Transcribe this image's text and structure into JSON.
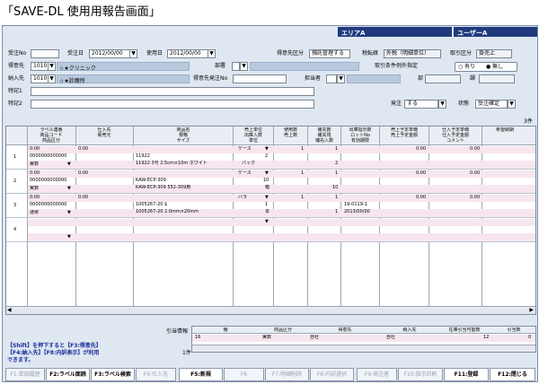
{
  "page_title": "「SAVE-DL 使用用報告画面」",
  "header": {
    "area": "エリアA",
    "user": "ユーザーA"
  },
  "form": {
    "juchu_no_label": "受注No",
    "juchu_no": "",
    "juchu_date_label": "受注日",
    "juchu_date": "2012/00/00",
    "use_date_label": "使用日",
    "use_date": "2012/00/00",
    "client_type_label": "得意先区分",
    "client_type": "預託管理する",
    "tax_label": "税転嫁",
    "tax": "外税（明細単位）",
    "deal_type_label": "取引区分",
    "deal_type": "掛売上",
    "client_label": "得意先",
    "client_code": "1010",
    "client_name": "☆★クリニック",
    "dept_label": "部署",
    "dept": "",
    "cond_label": "取引条件例外指定",
    "cond_yes": "有り",
    "cond_no": "無し",
    "dest_label": "納入先",
    "dest_code": "1010",
    "dest_name": "☆★診療所",
    "order_no_label": "得意先発注No",
    "order_no": "",
    "staff_label": "担当者",
    "staff": "",
    "section_label": "部",
    "section": "",
    "division_label": "課",
    "division": "",
    "note1_label": "特記1",
    "note1": "",
    "note2_label": "特記2",
    "note2": "",
    "order_flag_label": "発注",
    "order_flag": "する",
    "status_label": "状態",
    "status": "受注確定"
  },
  "grid": {
    "count": "3件",
    "headers": [
      [
        "ラベル連番",
        "商品コード",
        "商品区分"
      ],
      [
        "仕入先",
        "",
        "販売元"
      ],
      [
        "商品名",
        "規格",
        "サイズ"
      ],
      [
        "売上単位",
        "出庫入数",
        "単位"
      ],
      [
        "使用数",
        "売上数",
        ""
      ],
      [
        "補充数",
        "補充残",
        "補充入数"
      ],
      [
        "出庫指示数",
        "ロットNo",
        "有効期限"
      ],
      [
        "売上予定単価",
        "売上予定金額",
        ""
      ],
      [
        "仕入予定単価",
        "仕入予定金額",
        "コメント"
      ],
      [
        "希望納期",
        "",
        ""
      ]
    ],
    "rows": [
      {
        "no": "1",
        "time": "0:00",
        "time2": "0:00",
        "code": "0000000000000",
        "cat": "実数",
        "name": "11922",
        "spec": "11922 3号 2.5cm×10m ホワイト",
        "unit": "ケース",
        "inner": "2",
        "unit2": "パック",
        "use": "1",
        "rep": "1",
        "rep_in": "2",
        "sp": "0.00",
        "pp": "0.00"
      },
      {
        "no": "2",
        "time": "0:00",
        "time2": "0:00",
        "code": "0000000000000",
        "cat": "実数",
        "name": "KAW-ECP-309",
        "spec": "KAW-ECP-309 552-309用",
        "unit": "ケース",
        "inner": "10",
        "unit2": "箱",
        "use": "1",
        "rep": "1",
        "rep_in": "10",
        "sp": "0.00",
        "pp": "0.00"
      },
      {
        "no": "3",
        "time": "0:00",
        "time2": "0:00",
        "code": "0000000000000",
        "cat": "通常",
        "name": "1005267-20 $",
        "spec": "1005267-20 2.0mm×20mm",
        "unit": "バラ",
        "inner": "1",
        "unit2": "本",
        "use": "1",
        "rep": "1",
        "rep_in": "1",
        "lot": "19-0119-1",
        "exp": "2013/00/00",
        "sp": "0.00",
        "pp": "0.00"
      },
      {
        "no": "4"
      }
    ]
  },
  "sub": {
    "label": "引当情報",
    "headers": [
      "棚",
      "商品区分",
      "得意先",
      "納入先",
      "在庫引当可能数",
      "引当数"
    ],
    "row": {
      "shelf": "16",
      "cat": "実数",
      "client": "自社",
      "dest": "自社",
      "avail": "12",
      "alloc": "0"
    },
    "count": "1件"
  },
  "help": [
    "【Shift】を押下すると【F3:得意先】",
    "【F4:納入先】【F8:内訳表示】が利用",
    "できます。"
  ],
  "fkeys": [
    {
      "label": "F1:単価履歴",
      "on": false
    },
    {
      "label": "F2:ラベル面読",
      "on": true
    },
    {
      "label": "F3:ラベル検索",
      "on": true
    },
    {
      "label": "F4:仕入先",
      "on": false
    },
    {
      "label": "F5:新規",
      "on": true
    },
    {
      "label": "F6",
      "on": false
    },
    {
      "label": "F7:明細削除",
      "on": false
    },
    {
      "label": "F8:内訳選択",
      "on": false
    },
    {
      "label": "F9:発注者",
      "on": false
    },
    {
      "label": "F10:指示印刷",
      "on": false
    },
    {
      "label": "F11:登録",
      "on": true
    },
    {
      "label": "F12:閉じる",
      "on": true
    }
  ],
  "colors": {
    "header_navy": "#203a7d",
    "panel": "#dfe7f1",
    "row_pink": "#f7e6ef",
    "help_text": "#1a2c9a"
  }
}
